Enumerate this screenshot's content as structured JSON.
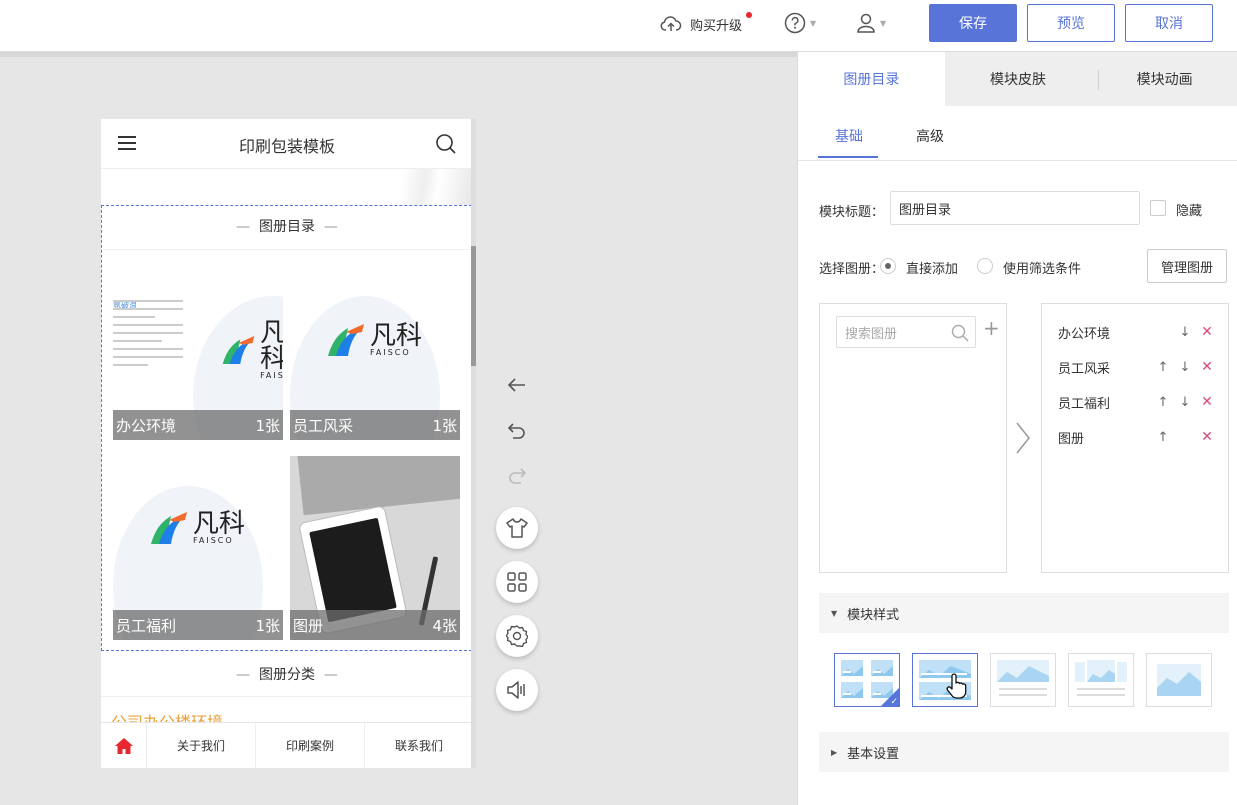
{
  "topbar": {
    "upgrade_label": "购买升级",
    "save_label": "保存",
    "preview_label": "预览",
    "cancel_label": "取消",
    "accent_color": "#5874d8"
  },
  "phone": {
    "title": "印刷包装模板",
    "module_title": "图册目录",
    "albums": [
      {
        "name": "办公环境",
        "count": "1张"
      },
      {
        "name": "员工风采",
        "count": "1张"
      },
      {
        "name": "员工福利",
        "count": "1张"
      },
      {
        "name": "图册",
        "count": "4张"
      }
    ],
    "logo_cn": "凡科",
    "logo_en": "FAISCO",
    "doc_heading": "氛破浪",
    "category_title": "图册分类",
    "category_item": "公司办公楼环境",
    "nav": [
      "关于我们",
      "印刷案例",
      "联系我们"
    ]
  },
  "tools": [
    "back-arrow-icon",
    "undo-icon",
    "redo-icon",
    "shirt-icon",
    "grid-icon",
    "settings-icon",
    "speaker-icon"
  ],
  "panel": {
    "tabs": [
      "图册目录",
      "模块皮肤",
      "模块动画"
    ],
    "subtabs": [
      "基础",
      "高级"
    ],
    "module_title_label": "模块标题：",
    "module_title_value": "图册目录",
    "hide_label": "隐藏",
    "select_album_label": "选择图册：",
    "radio_direct": "直接添加",
    "radio_filter": "使用筛选条件",
    "manage_button": "管理图册",
    "search_placeholder": "搜索图册",
    "selected_albums": [
      {
        "name": "办公环境",
        "up": false,
        "down": true
      },
      {
        "name": "员工风采",
        "up": true,
        "down": true
      },
      {
        "name": "员工福利",
        "up": true,
        "down": true
      },
      {
        "name": "图册",
        "up": true,
        "down": false
      }
    ],
    "style_section": "模块样式",
    "basic_section": "基本设置",
    "selected_style_index": 0
  }
}
